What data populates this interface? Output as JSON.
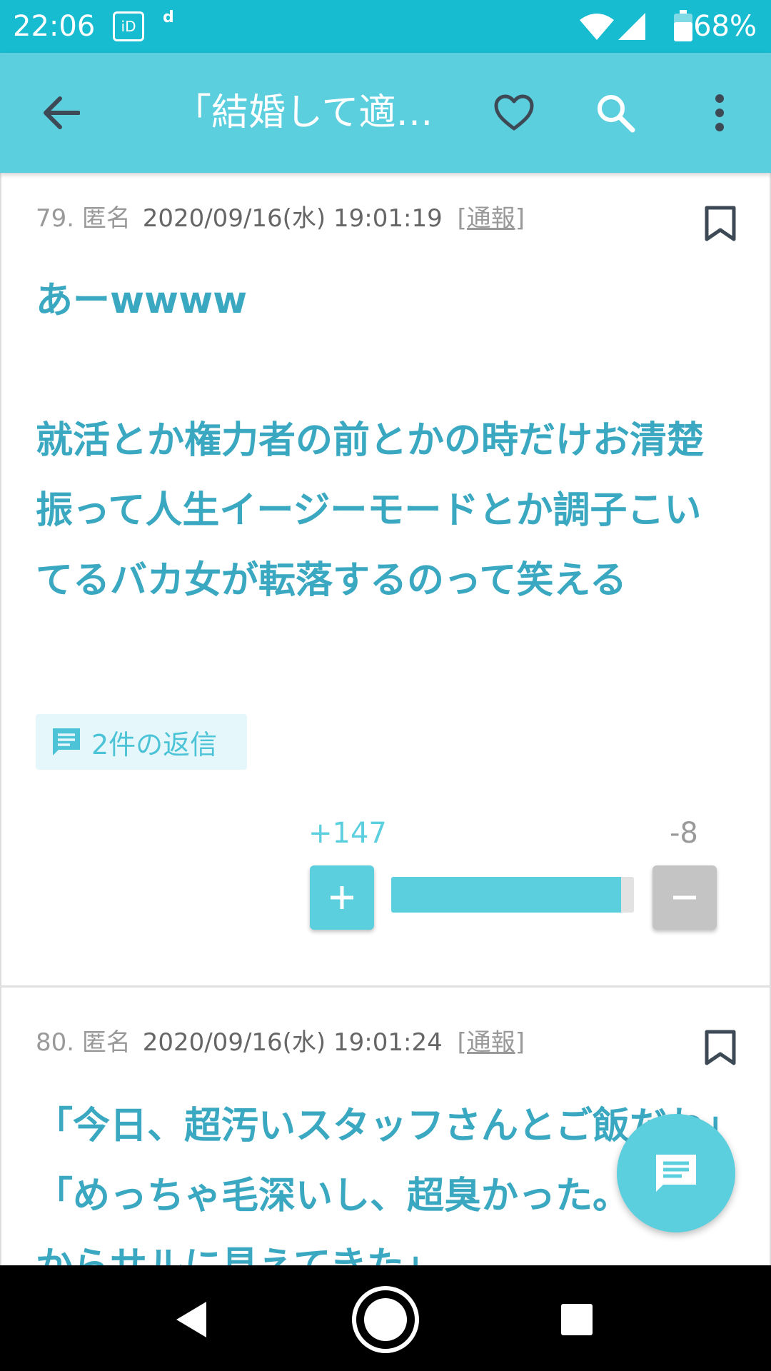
{
  "status_bar": {
    "time": "22:06",
    "icon_id": "iD",
    "icon_d": "d",
    "battery": "68%"
  },
  "toolbar": {
    "title": "「結婚して適…"
  },
  "posts": [
    {
      "number": "79.",
      "author": "匿名",
      "date": "2020/09/16(水) 19:01:19",
      "report": "[通報]",
      "body": "あーwwww\n\n就活とか権力者の前とかの時だけお清楚振って人生イージーモードとか調子こいてるバカ女が転落するのって笑える",
      "replies": "2件の返信",
      "plus": "+147",
      "minus": "-8",
      "plus_ratio": 0.948
    },
    {
      "number": "80.",
      "author": "匿名",
      "date": "2020/09/16(水) 19:01:24",
      "report": "[通報]",
      "body": "「今日、超汚いスタッフさんとご飯だわ」「めっちゃ毛深いし、超臭かった。途中からサルに見えてきた」"
    }
  ],
  "colors": {
    "status_bar": "#17bcd0",
    "toolbar": "#5ccfdf",
    "body_text": "#3aa8c1",
    "plus": "#5ccfdf",
    "minus": "#c4c4c4"
  }
}
